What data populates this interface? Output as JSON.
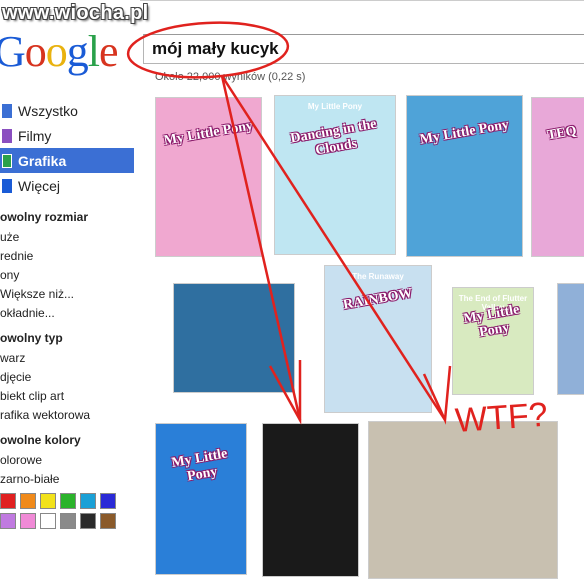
{
  "watermark": "www.wiocha.pl",
  "logo": [
    "G",
    "o",
    "o",
    "g",
    "l",
    "e"
  ],
  "search": {
    "query": "mój mały kucyk"
  },
  "stats": "Około 22,000 wyników (0,22 s)",
  "nav": [
    {
      "label": "Wszystko",
      "icon": "wszystko-icon",
      "color": "#3b6fd4"
    },
    {
      "label": "Filmy",
      "icon": "film-icon",
      "color": "#8a4fc0"
    },
    {
      "label": "Grafika",
      "icon": "image-icon",
      "color": "#2aa14a"
    },
    {
      "label": "Więcej",
      "icon": "more-icon",
      "color": "#1a5bd6"
    }
  ],
  "size_section": {
    "title": "owolny rozmiar",
    "items": [
      "uże",
      "rednie",
      "ony",
      "Większe niż...",
      "okładnie..."
    ]
  },
  "type_section": {
    "title": "owolny typ",
    "items": [
      "warz",
      "djęcie",
      "biekt clip art",
      "rafika wektorowa"
    ]
  },
  "color_section": {
    "title": "owolne kolory",
    "items": [
      "olorowe",
      "zarno-białe"
    ],
    "swatches": [
      "#e02020",
      "#f08a1a",
      "#f2e21a",
      "#2bb32b",
      "#1aa0d6",
      "#2a2ad6",
      "#c07ae0",
      "#f08ad6",
      "#ffffff",
      "#8a8a8a",
      "#2a2a2a",
      "#8a5a2a"
    ]
  },
  "thumbs": [
    {
      "title": "My Little Pony",
      "sub": "",
      "bg": "#f0a8d0"
    },
    {
      "title": "Dancing in the Clouds",
      "sub": "My Little Pony",
      "bg": "#bfe6f2"
    },
    {
      "title": "My Little Pony",
      "sub": "",
      "bg": "#4fa3d8"
    },
    {
      "title": "TEQ",
      "sub": "",
      "bg": "#e8a8d8"
    },
    {
      "title": "",
      "sub": "",
      "bg": "#2f6fa0"
    },
    {
      "title": "RAINBOW",
      "sub": "The Runaway",
      "bg": "#c8e0f0"
    },
    {
      "title": "My Little Pony",
      "sub": "The End of Flutter Valley",
      "bg": "#d8eac0"
    },
    {
      "title": "",
      "sub": "",
      "bg": "#90b0d8"
    },
    {
      "title": "My Little Pony",
      "sub": "",
      "bg": "#2a7fd8"
    },
    {
      "title": "",
      "sub": "",
      "bg": "#1a1a1a"
    },
    {
      "title": "",
      "sub": "",
      "bg": "#c8c0b0"
    }
  ],
  "annotation": "WTF?"
}
